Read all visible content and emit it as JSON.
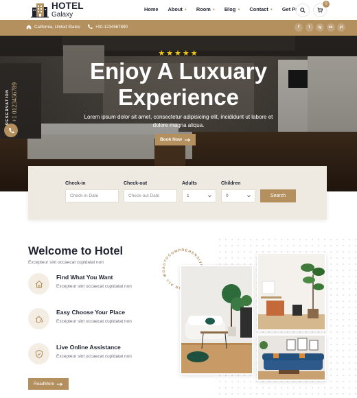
{
  "brand": {
    "name": "HOTEL",
    "sub": "Galaxy"
  },
  "nav": [
    {
      "label": "Home"
    },
    {
      "label": "About"
    },
    {
      "label": "Room"
    },
    {
      "label": "Blog"
    },
    {
      "label": "Contact"
    },
    {
      "label": "Get Pro"
    }
  ],
  "header": {
    "cart_count": "0"
  },
  "topbar": {
    "location": "California, United States",
    "phone": "+00-1234567890",
    "social": [
      "f",
      "t",
      "ig",
      "sk",
      "yt"
    ]
  },
  "hero": {
    "stars": "★★★★★",
    "title_line1": "Enjoy A Luxuary",
    "title_line2": "Experience",
    "desc": "Lorem ipsum dolor sit amet, consectetur adipisicing elit, incididunt ut labore et dolore magna aliqua.",
    "book_now": "Book Now",
    "reservation_label": "RESERVATION",
    "reservation_phone": "+1 0123456789"
  },
  "booking": {
    "checkin_label": "Check-in",
    "checkin_placeholder": "Check-in Date",
    "checkout_label": "Check-out",
    "checkout_placeholder": "Check-out Date",
    "adults_label": "Adults",
    "adults_value": "1",
    "children_label": "Children",
    "children_value": "0",
    "search_label": "Search"
  },
  "welcome": {
    "title": "Welcome to Hotel",
    "subtitle": "Excepteur sint occaecat cupidatat non",
    "features": [
      {
        "title": "Find What You Want",
        "desc": "Excepteur sint occaecat cupidatat non",
        "icon": "house-icon"
      },
      {
        "title": "Easy Choose Your Place",
        "desc": "Excepteur sint occaecat cupidatat non",
        "icon": "location-home-icon"
      },
      {
        "title": "Live Online Assistance",
        "desc": "Excepteur sint occaecat cupidatat non",
        "icon": "shield-icon"
      }
    ],
    "read_more": "ReadMore",
    "circle_text": "AUTOCOMPREHENSIVE WARRANTY ON ALL WORK IN"
  },
  "colors": {
    "accent": "#b4905f",
    "dark": "#1f2230",
    "booking_bg": "#eeeae2"
  }
}
